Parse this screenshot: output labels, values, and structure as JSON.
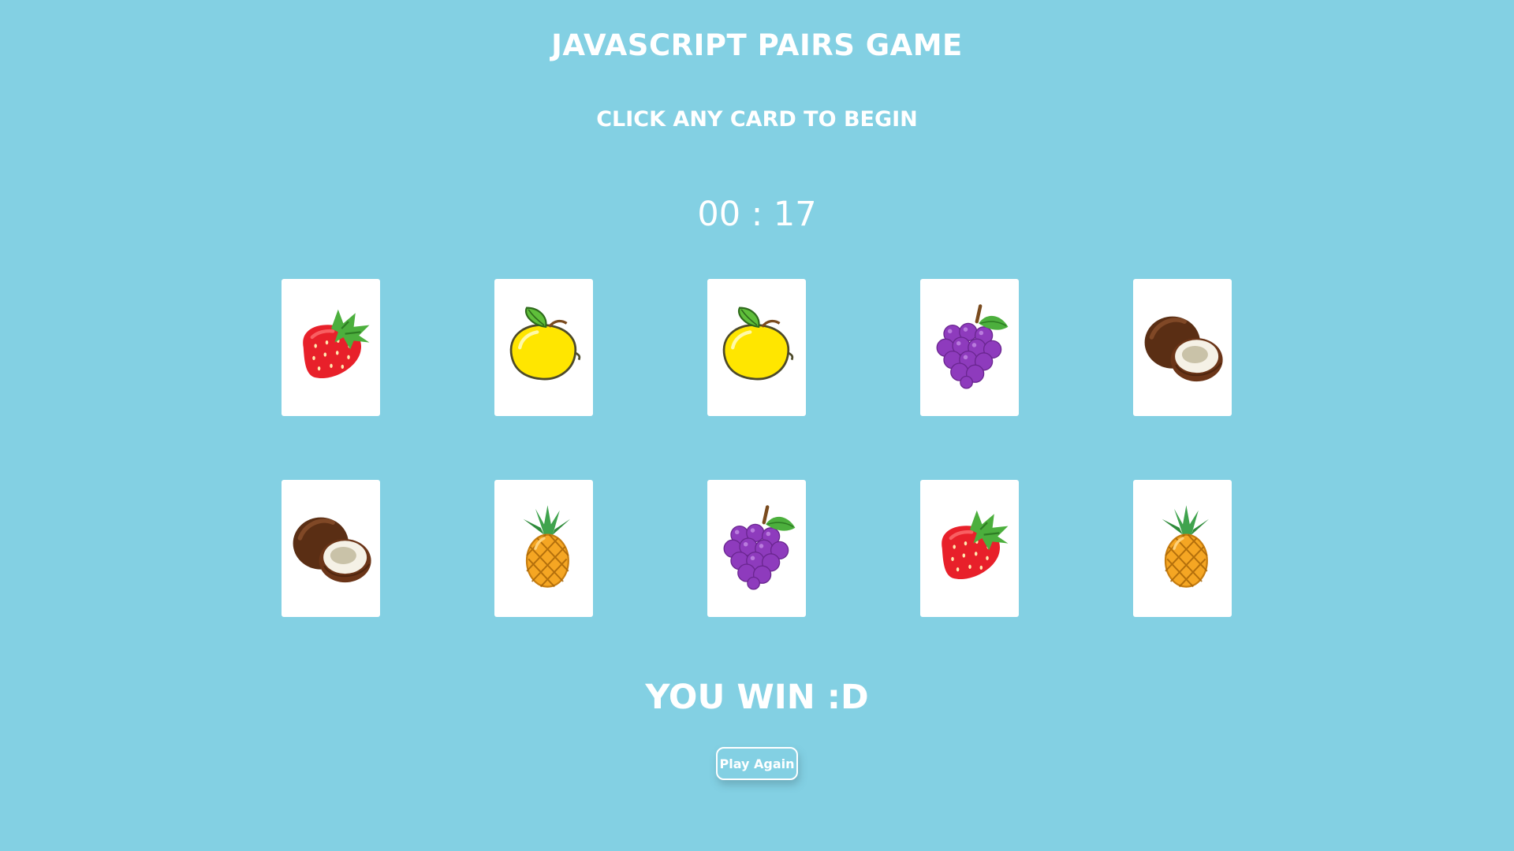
{
  "header": {
    "title": "JAVASCRIPT PAIRS GAME",
    "subtitle": "CLICK ANY CARD TO BEGIN"
  },
  "timer": {
    "text": "00 : 17"
  },
  "cards": [
    {
      "fruit": "strawberry"
    },
    {
      "fruit": "lemon"
    },
    {
      "fruit": "lemon"
    },
    {
      "fruit": "grapes"
    },
    {
      "fruit": "coconut"
    },
    {
      "fruit": "coconut"
    },
    {
      "fruit": "pineapple"
    },
    {
      "fruit": "grapes"
    },
    {
      "fruit": "strawberry"
    },
    {
      "fruit": "pineapple"
    }
  ],
  "result": {
    "message": "YOU WIN :D",
    "play_again_label": "Play Again"
  },
  "colors": {
    "background": "#83d0e3",
    "card": "#ffffff",
    "text": "#ffffff"
  }
}
